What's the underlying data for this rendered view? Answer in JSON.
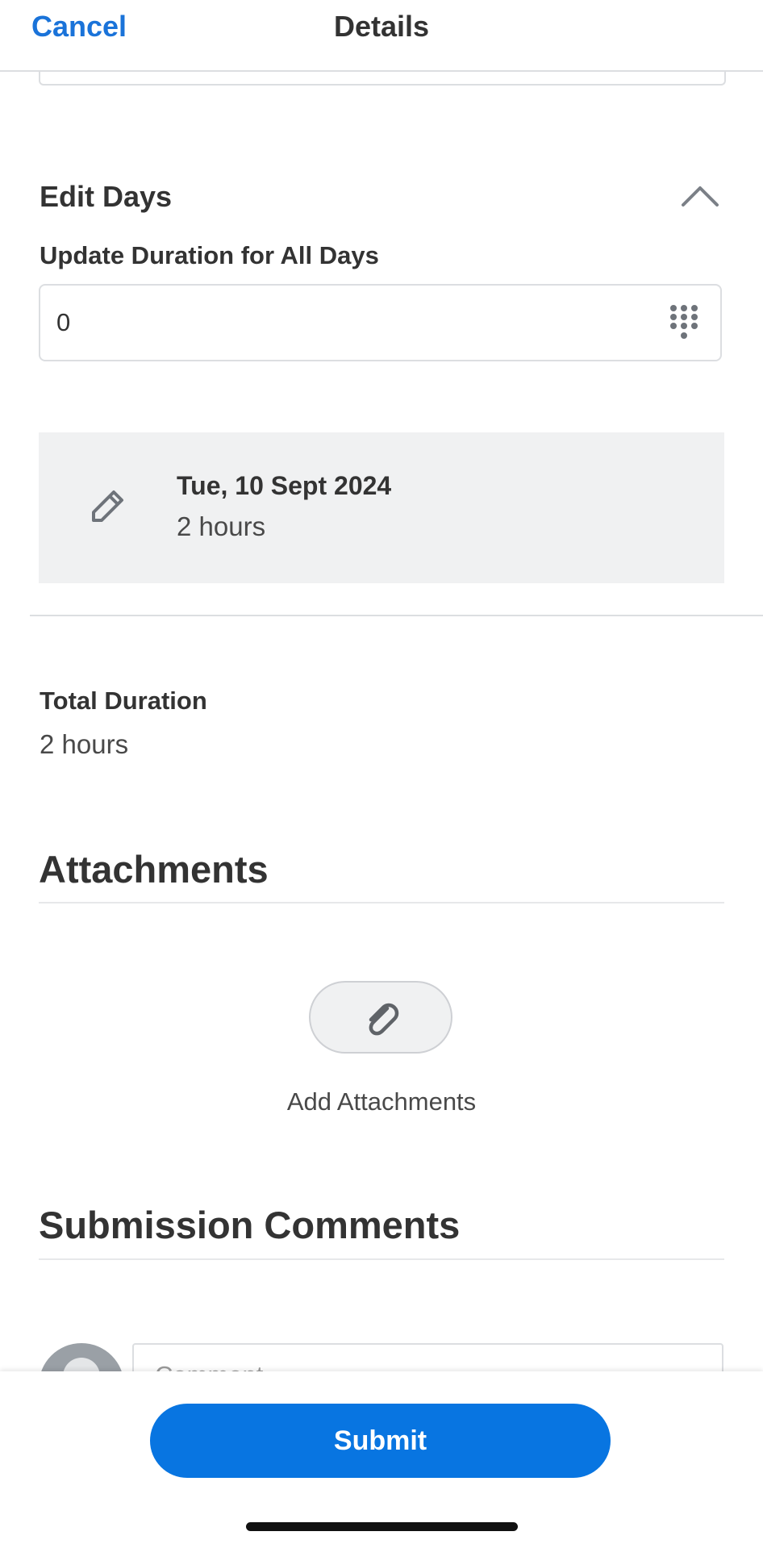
{
  "nav": {
    "cancel_label": "Cancel",
    "title": "Details"
  },
  "edit_days": {
    "heading": "Edit Days",
    "collapse_icon": "chevron-up-icon",
    "update_label": "Update Duration for All Days",
    "update_value": "0",
    "keypad_icon": "keypad-icon",
    "days": [
      {
        "date": "Tue, 10 Sept 2024",
        "duration": "2 hours",
        "icon": "pencil-icon"
      }
    ]
  },
  "total": {
    "label": "Total Duration",
    "value": "2 hours"
  },
  "attachments": {
    "heading": "Attachments",
    "button_icon": "paperclip-icon",
    "add_label": "Add Attachments"
  },
  "comments": {
    "heading": "Submission Comments",
    "placeholder": "Comment"
  },
  "footer": {
    "submit_label": "Submit"
  },
  "colors": {
    "accent": "#0875e1",
    "link": "#1a73d9",
    "text": "#333333",
    "card_bg": "#f0f1f2"
  }
}
